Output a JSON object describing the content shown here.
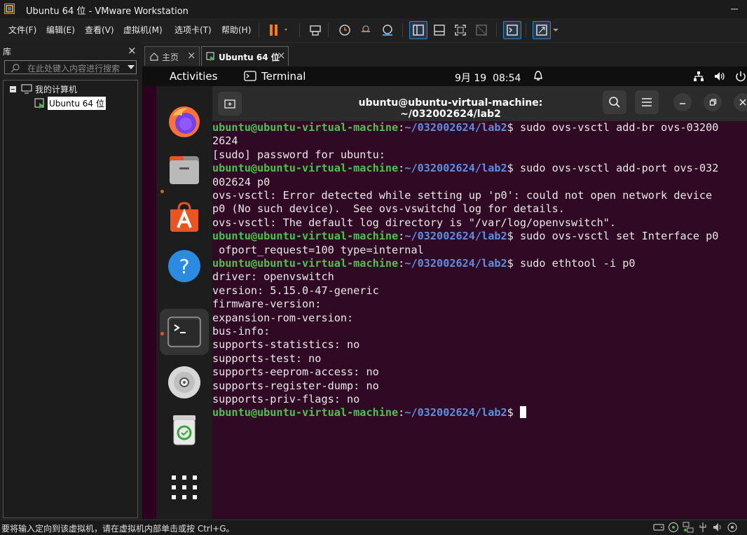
{
  "window": {
    "title": "Ubuntu 64 位 - VMware Workstation"
  },
  "menu": {
    "items": [
      "文件(F)",
      "编辑(E)",
      "查看(V)",
      "虚拟机(M)",
      "选项卡(T)",
      "帮助(H)"
    ]
  },
  "library": {
    "title": "库",
    "close": "×",
    "search_placeholder": "在此处键入内容进行搜索",
    "tree": {
      "root": "我的计算机",
      "child": "Ubuntu 64 位"
    }
  },
  "tabs": [
    {
      "label": "主页",
      "close": "×"
    },
    {
      "label": "Ubuntu 64 位",
      "close": "×"
    }
  ],
  "gnome": {
    "activities": "Activities",
    "app": "Terminal",
    "clock": "9月 19  08:54"
  },
  "terminal": {
    "title": "ubuntu@ubuntu-virtual-machine: ~/032002624/lab2",
    "prompt_user": "ubuntu@ubuntu-virtual-machine",
    "prompt_colon": ":",
    "prompt_path": "~/032002624/lab2",
    "prompt_dollar": "$ ",
    "lines": [
      {
        "type": "prompt",
        "cmd": "sudo ovs-vsctl add-br ovs-03200"
      },
      {
        "type": "out",
        "text": "2624"
      },
      {
        "type": "out",
        "text": "[sudo] password for ubuntu:"
      },
      {
        "type": "prompt",
        "cmd": "sudo ovs-vsctl add-port ovs-032"
      },
      {
        "type": "out",
        "text": "002624 p0"
      },
      {
        "type": "out",
        "text": "ovs-vsctl: Error detected while setting up 'p0': could not open network device"
      },
      {
        "type": "out",
        "text": "p0 (No such device).  See ovs-vswitchd log for details."
      },
      {
        "type": "out",
        "text": "ovs-vsctl: The default log directory is \"/var/log/openvswitch\"."
      },
      {
        "type": "prompt",
        "cmd": "sudo ovs-vsctl set Interface p0"
      },
      {
        "type": "out",
        "text": " ofport_request=100 type=internal"
      },
      {
        "type": "prompt",
        "cmd": "sudo ethtool -i p0"
      },
      {
        "type": "out",
        "text": "driver: openvswitch"
      },
      {
        "type": "out",
        "text": "version: 5.15.0-47-generic"
      },
      {
        "type": "out",
        "text": "firmware-version:"
      },
      {
        "type": "out",
        "text": "expansion-rom-version:"
      },
      {
        "type": "out",
        "text": "bus-info:"
      },
      {
        "type": "out",
        "text": "supports-statistics: no"
      },
      {
        "type": "out",
        "text": "supports-test: no"
      },
      {
        "type": "out",
        "text": "supports-eeprom-access: no"
      },
      {
        "type": "out",
        "text": "supports-register-dump: no"
      },
      {
        "type": "out",
        "text": "supports-priv-flags: no"
      },
      {
        "type": "prompt",
        "cmd": ""
      }
    ]
  },
  "statusbar": {
    "text": "要将输入定向到该虚拟机，请在虚拟机内部单击或按 Ctrl+G。"
  },
  "colors": {
    "accent": "#2d89c8",
    "terminal_bg": "#300a24",
    "prompt_user": "#4ec14e",
    "prompt_path": "#5e8ee0",
    "ubuntu_orange": "#e95420"
  },
  "icons": [
    "vmware-icon",
    "pause-icon",
    "send-ctrl-alt-del-icon",
    "snapshot-icon",
    "revert-snapshot-icon",
    "manage-snapshots-icon",
    "library-view-icon",
    "thumbnail-view-icon",
    "fullscreen-icon",
    "unity-icon",
    "console-icon",
    "stretch-icon",
    "firefox-icon",
    "files-icon",
    "software-icon",
    "help-icon",
    "terminal-icon",
    "dvd-icon",
    "trash-icon",
    "show-apps-icon",
    "search-icon",
    "menu-icon",
    "minimize-icon",
    "maximize-icon",
    "close-icon",
    "network-icon",
    "volume-icon",
    "power-icon",
    "accessibility-icon"
  ]
}
